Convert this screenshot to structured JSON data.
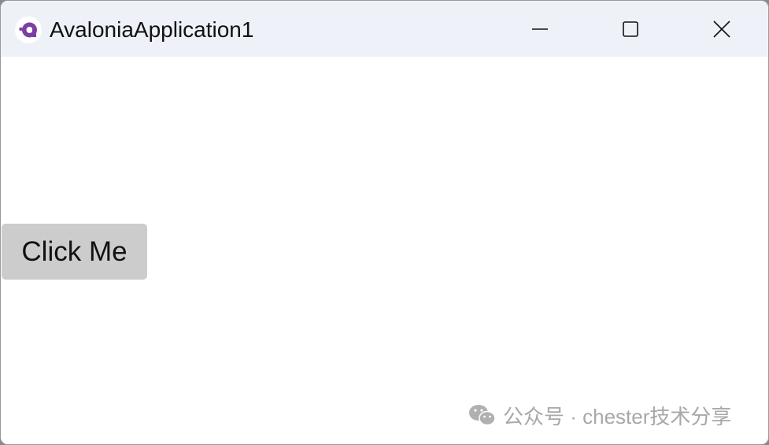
{
  "window": {
    "title": "AvaloniaApplication1",
    "app_icon": "avalonia-logo-icon",
    "controls": {
      "minimize": "minimize-icon",
      "maximize": "maximize-icon",
      "close": "close-icon"
    }
  },
  "content": {
    "button_label": "Click Me"
  },
  "watermark": {
    "icon": "wechat-icon",
    "text": "公众号 · chester技术分享"
  },
  "colors": {
    "titlebar": "#eef2f8",
    "button": "#cccccc",
    "brand": "#7b3fa3"
  }
}
